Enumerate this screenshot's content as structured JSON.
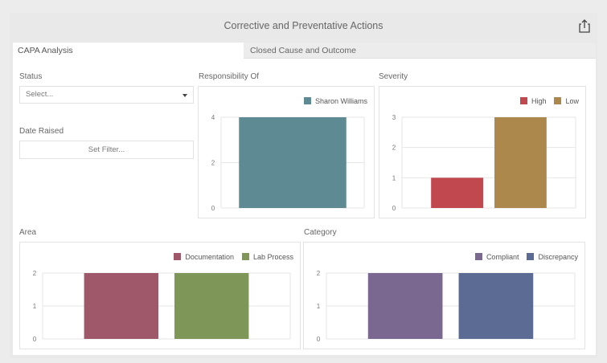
{
  "dashboard": {
    "title": "Corrective and Preventative Actions",
    "export_icon": "share-export-icon"
  },
  "tabs": [
    {
      "label": "CAPA Analysis",
      "active": true
    },
    {
      "label": "Closed Cause and Outcome",
      "active": false
    }
  ],
  "filters": {
    "status_label": "Status",
    "status_value": "Select...",
    "date_label": "Date Raised",
    "date_button": "Set Filter..."
  },
  "chart_data": [
    {
      "id": "responsibility",
      "title": "Responsibility Of",
      "type": "bar",
      "ylim": [
        0,
        4
      ],
      "yticks": [
        "0",
        "2",
        "4"
      ],
      "series": [
        {
          "name": "Sharon Williams",
          "values": [
            4
          ],
          "color": "#5e8a93"
        }
      ]
    },
    {
      "id": "severity",
      "title": "Severity",
      "type": "bar",
      "ylim": [
        0,
        3
      ],
      "yticks": [
        "0",
        "1",
        "2",
        "3"
      ],
      "series": [
        {
          "name": "High",
          "values": [
            1
          ],
          "color": "#c1484e"
        },
        {
          "name": "Low",
          "values": [
            3
          ],
          "color": "#ac884d"
        }
      ]
    },
    {
      "id": "area",
      "title": "Area",
      "type": "bar",
      "ylim": [
        0,
        2
      ],
      "yticks": [
        "0",
        "1",
        "2"
      ],
      "series": [
        {
          "name": "Documentation",
          "values": [
            2
          ],
          "color": "#9f5869"
        },
        {
          "name": "Lab Process",
          "values": [
            2
          ],
          "color": "#7f9659"
        }
      ]
    },
    {
      "id": "category",
      "title": "Category",
      "type": "bar",
      "ylim": [
        0,
        2
      ],
      "yticks": [
        "0",
        "1",
        "2"
      ],
      "series": [
        {
          "name": "Compliant",
          "values": [
            2
          ],
          "color": "#7b6890"
        },
        {
          "name": "Discrepancy",
          "values": [
            2
          ],
          "color": "#5c6b94"
        }
      ]
    }
  ]
}
